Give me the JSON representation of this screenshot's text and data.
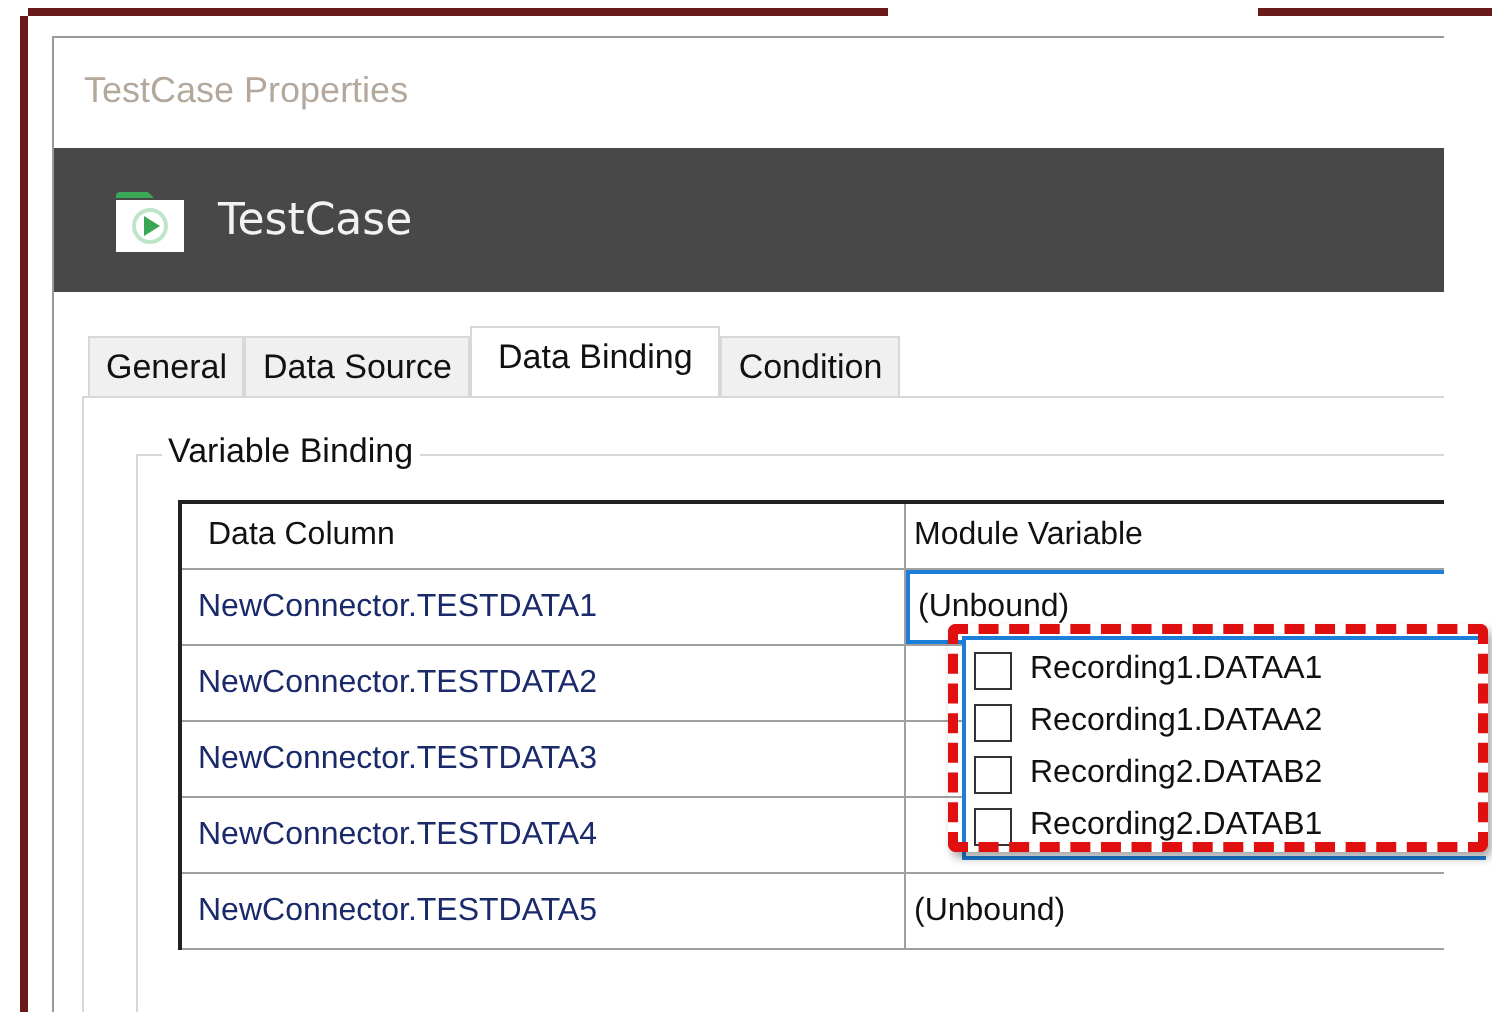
{
  "window": {
    "title": "TestCase Properties"
  },
  "header": {
    "title": "TestCase"
  },
  "tabs": [
    {
      "label": "General",
      "selected": false
    },
    {
      "label": "Data Source",
      "selected": false
    },
    {
      "label": "Data Binding",
      "selected": true
    },
    {
      "label": "Condition",
      "selected": false
    }
  ],
  "group": {
    "title": "Variable Binding"
  },
  "table": {
    "columns": [
      "Data Column",
      "Module Variable"
    ],
    "rows": [
      {
        "data_column": "NewConnector.TESTDATA1",
        "module_variable": "(Unbound)",
        "focused": true
      },
      {
        "data_column": "NewConnector.TESTDATA2",
        "focused": false
      },
      {
        "data_column": "NewConnector.TESTDATA3",
        "focused": false
      },
      {
        "data_column": "NewConnector.TESTDATA4",
        "focused": false
      },
      {
        "data_column": "NewConnector.TESTDATA5",
        "module_variable": "(Unbound)",
        "focused": false
      }
    ]
  },
  "dropdown": {
    "options": [
      {
        "label": "Recording1.DATAA1",
        "checked": false
      },
      {
        "label": "Recording1.DATAA2",
        "checked": false
      },
      {
        "label": "Recording2.DATAB2",
        "checked": false
      },
      {
        "label": "Recording2.DATAB1",
        "checked": false
      }
    ]
  }
}
